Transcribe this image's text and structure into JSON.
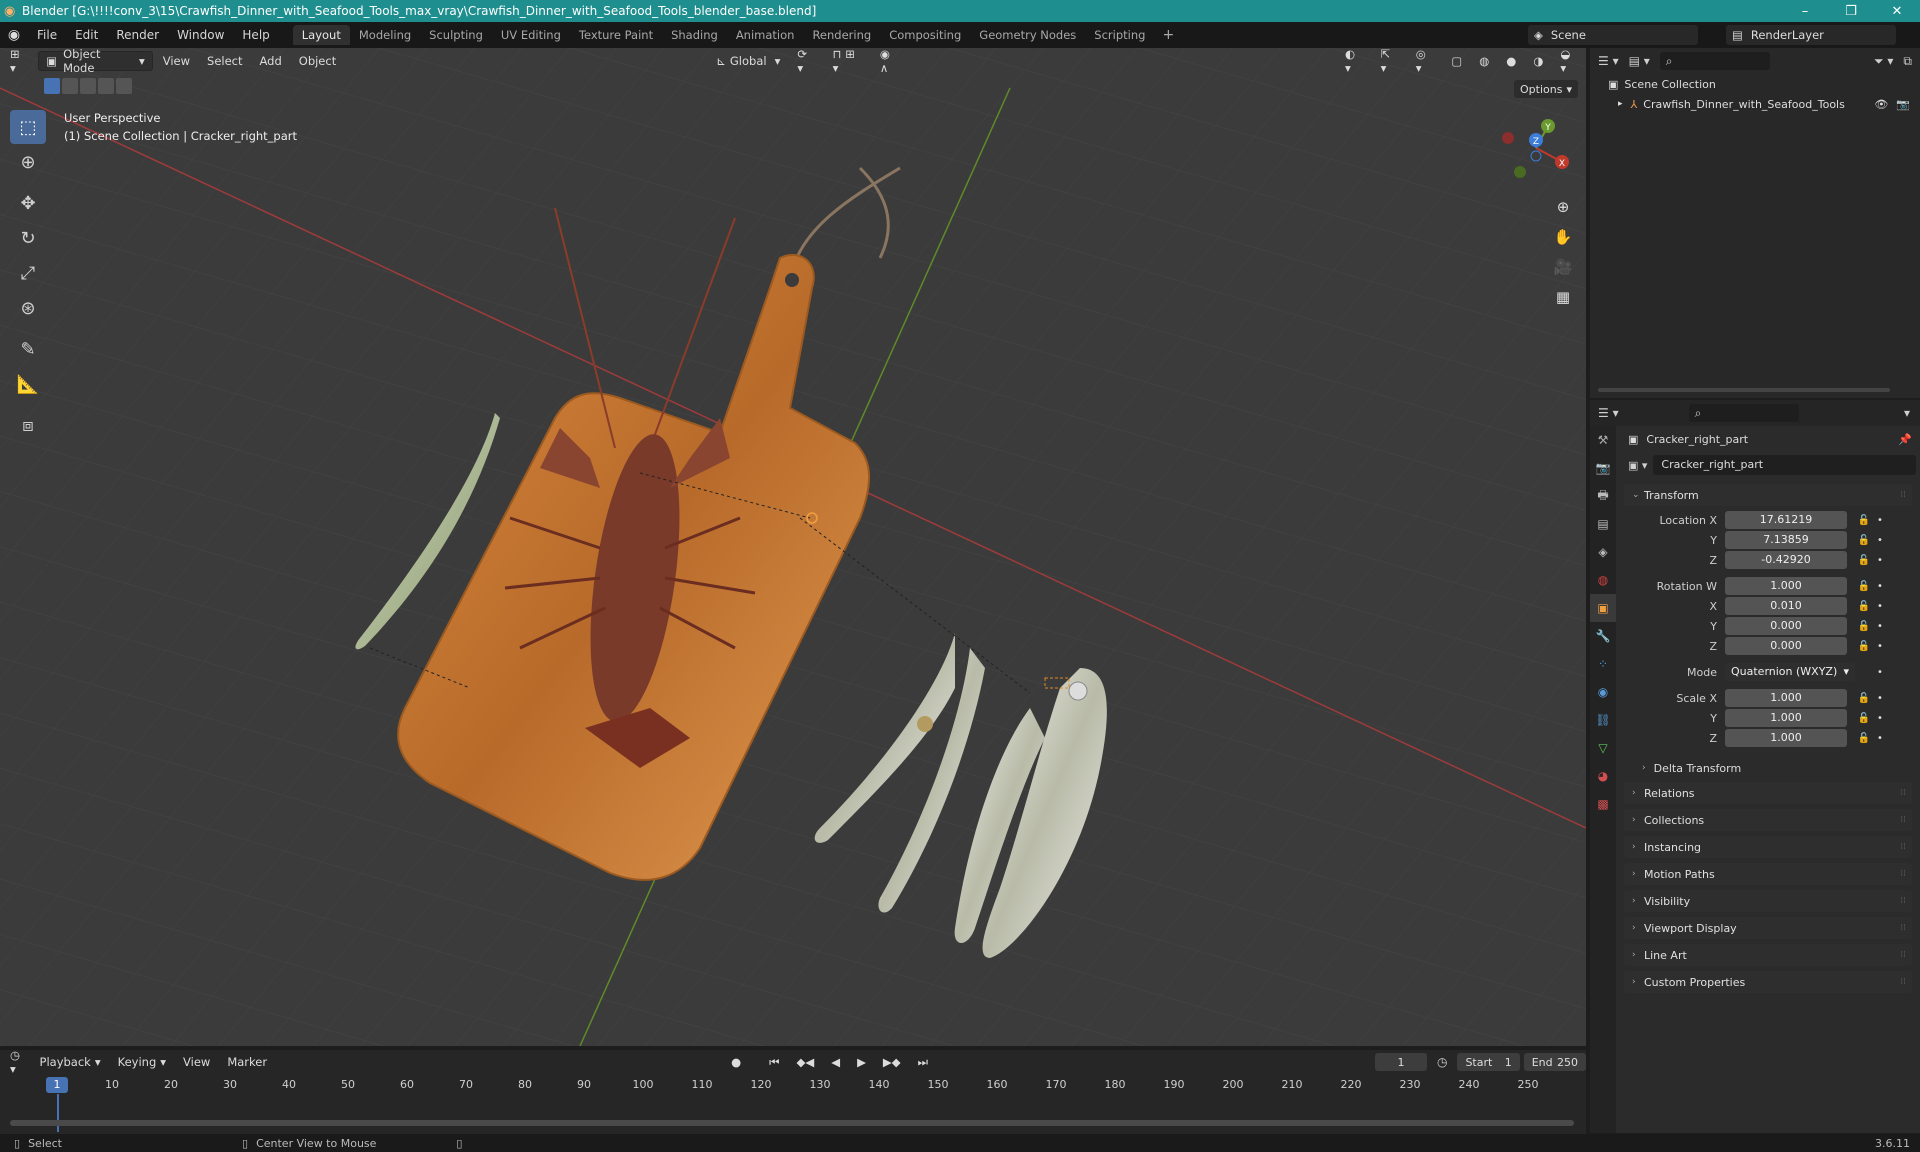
{
  "window": {
    "title": "Blender [G:\\!!!!conv_3\\15\\Crawfish_Dinner_with_Seafood_Tools_max_vray\\Crawfish_Dinner_with_Seafood_Tools_blender_base.blend]"
  },
  "menu": [
    "File",
    "Edit",
    "Render",
    "Window",
    "Help"
  ],
  "workspaces": [
    "Layout",
    "Modeling",
    "Sculpting",
    "UV Editing",
    "Texture Paint",
    "Shading",
    "Animation",
    "Rendering",
    "Compositing",
    "Geometry Nodes",
    "Scripting"
  ],
  "active_workspace": "Layout",
  "scene": {
    "name": "Scene",
    "view_layer": "RenderLayer"
  },
  "viewport": {
    "mode": "Object Mode",
    "menus": [
      "View",
      "Select",
      "Add",
      "Object"
    ],
    "orientation": "Global",
    "options_label": "Options",
    "view_name": "User Perspective",
    "context": "(1) Scene Collection | Cracker_right_part"
  },
  "gizmo": {
    "x": "X",
    "y": "Y",
    "z": "Z"
  },
  "outliner": {
    "root": "Scene Collection",
    "items": [
      {
        "name": "Crawfish_Dinner_with_Seafood_Tools"
      }
    ]
  },
  "properties": {
    "object_name": "Cracker_right_part",
    "data_name": "Cracker_right_part",
    "transform_label": "Transform",
    "location": {
      "label": "Location X",
      "x": "17.61219",
      "y": "7.13859",
      "z": "-0.42920"
    },
    "rotation": {
      "label": "Rotation W",
      "w": "1.000",
      "x": "0.010",
      "y": "0.000",
      "z": "0.000"
    },
    "mode": {
      "label": "Mode",
      "value": "Quaternion (WXYZ)"
    },
    "scale": {
      "label": "Scale X",
      "x": "1.000",
      "y": "1.000",
      "z": "1.000"
    },
    "axis_labels": {
      "y": "Y",
      "z": "Z",
      "x": "X"
    },
    "delta_transform": "Delta Transform",
    "panels": [
      "Relations",
      "Collections",
      "Instancing",
      "Motion Paths",
      "Visibility",
      "Viewport Display",
      "Line Art",
      "Custom Properties"
    ]
  },
  "timeline": {
    "menus": [
      "Playback",
      "Keying",
      "View",
      "Marker"
    ],
    "current_frame": "1",
    "start_label": "Start",
    "start": "1",
    "end_label": "End",
    "end": "250",
    "ruler": [
      "10",
      "20",
      "30",
      "40",
      "50",
      "60",
      "70",
      "80",
      "90",
      "100",
      "110",
      "120",
      "130",
      "140",
      "150",
      "160",
      "170",
      "180",
      "190",
      "200",
      "210",
      "220",
      "230",
      "240",
      "250"
    ]
  },
  "status": {
    "left": "Select",
    "middle": "Center View to Mouse",
    "version": "3.6.11"
  },
  "colors": {
    "accent": "#4772b3",
    "titlebar": "#1e8e8e",
    "axis_x": "#c0392b",
    "axis_y": "#6a9a2e",
    "axis_z": "#3b7dd8"
  }
}
